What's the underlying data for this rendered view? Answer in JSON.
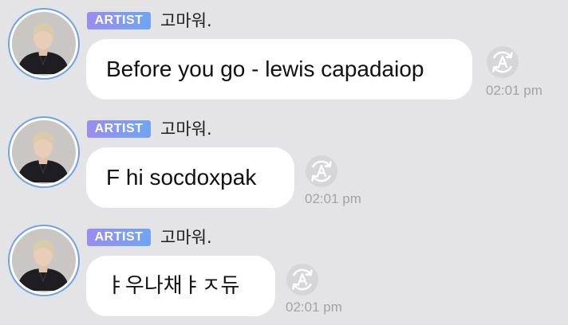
{
  "messages": [
    {
      "badge": "ARTIST",
      "name": "고마워.",
      "text": "Before you go - lewis capadaiop",
      "time": "02:01 pm"
    },
    {
      "badge": "ARTIST",
      "name": "고마워.",
      "text": "F  hi socdoxpak",
      "time": "02:01 pm"
    },
    {
      "badge": "ARTIST",
      "name": "고마워.",
      "text": "ㅑ우나채ㅑㅈ듀",
      "time": "02:01 pm"
    }
  ],
  "icons": {
    "avatar": "artist-avatar",
    "translate": "translate-icon"
  },
  "colors": {
    "background": "#e4e4e6",
    "bubble": "#ffffff",
    "badge_start": "#9a8cf0",
    "badge_end": "#6ea6f2",
    "avatar_ring": "#6fa3e6",
    "timestamp": "#a3a3a7"
  }
}
